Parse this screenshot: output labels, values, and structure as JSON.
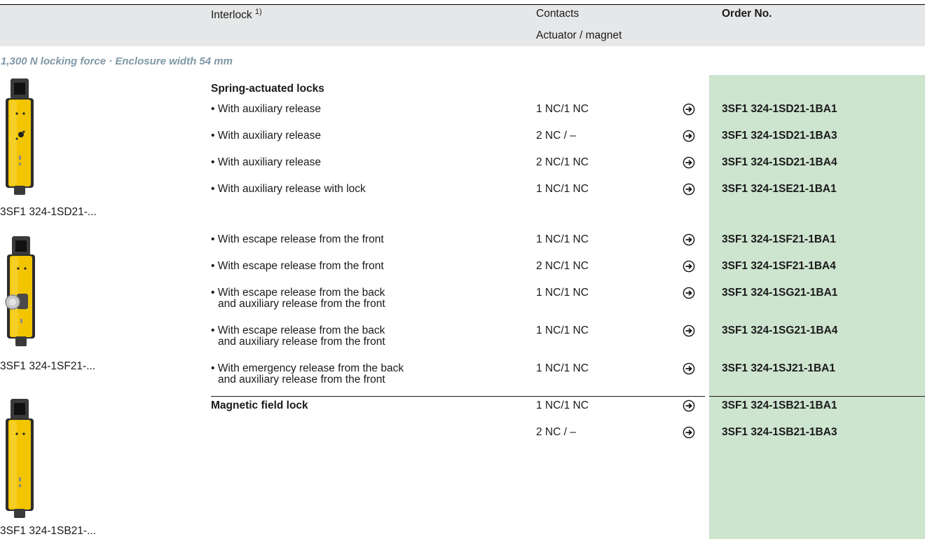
{
  "header": {
    "interlock_label": "Interlock",
    "interlock_footnote": "1)",
    "contacts_label": "Contacts",
    "actuator_label": "Actuator / magnet",
    "order_label": "Order No."
  },
  "section_title": "1,300 N locking force · Enclosure width 54 mm",
  "products": [
    {
      "label": "3SF1 324-1SD21-...",
      "image": "yellow-safety-switch-auxiliary-release"
    },
    {
      "label": "3SF1 324-1SF21-...",
      "image": "yellow-safety-switch-escape-release"
    },
    {
      "label": "3SF1 324-1SB21-...",
      "image": "yellow-safety-switch-magnetic"
    }
  ],
  "groups": {
    "spring": "Spring-actuated locks",
    "magnetic": "Magnetic field lock"
  },
  "rows": [
    {
      "desc": [
        "• With auxiliary release"
      ],
      "contacts": "1 NC/1 NC",
      "order": "3SF1 324-1SD21-1BA1"
    },
    {
      "desc": [
        "• With auxiliary release"
      ],
      "contacts": "2 NC / –",
      "order": "3SF1 324-1SD21-1BA3"
    },
    {
      "desc": [
        "• With auxiliary release"
      ],
      "contacts": "2 NC/1 NC",
      "order": "3SF1 324-1SD21-1BA4"
    },
    {
      "desc": [
        "• With auxiliary release with lock"
      ],
      "contacts": "1 NC/1 NC",
      "order": "3SF1 324-1SE21-1BA1"
    },
    {
      "desc": [
        "• With escape release from the front"
      ],
      "contacts": "1 NC/1 NC",
      "order": "3SF1 324-1SF21-1BA1"
    },
    {
      "desc": [
        "• With escape release from the front"
      ],
      "contacts": "2 NC/1 NC",
      "order": "3SF1 324-1SF21-1BA4"
    },
    {
      "desc": [
        "• With escape release from the back",
        "and auxiliary release from the front"
      ],
      "contacts": "1 NC/1 NC",
      "order": "3SF1 324-1SG21-1BA1"
    },
    {
      "desc": [
        "• With escape release from the back",
        "and auxiliary release from the front"
      ],
      "contacts": "1 NC/1 NC",
      "order": "3SF1 324-1SG21-1BA4"
    },
    {
      "desc": [
        "• With emergency release from the back",
        "and auxiliary release from the front"
      ],
      "contacts": "1 NC/1 NC",
      "order": "3SF1 324-1SJ21-1BA1"
    },
    {
      "desc": [],
      "contacts": "1 NC/1 NC",
      "order": "3SF1 324-1SB21-1BA1"
    },
    {
      "desc": [],
      "contacts": "2 NC / –",
      "order": "3SF1 324-1SB21-1BA3"
    }
  ],
  "colors": {
    "header_bg": "#e6e7e8",
    "order_column_bg": "#cde4cf",
    "section_title": "#7f98a6",
    "product_yellow": "#f2c500"
  },
  "icons": {
    "order_link": "circled-right-arrow-icon"
  }
}
